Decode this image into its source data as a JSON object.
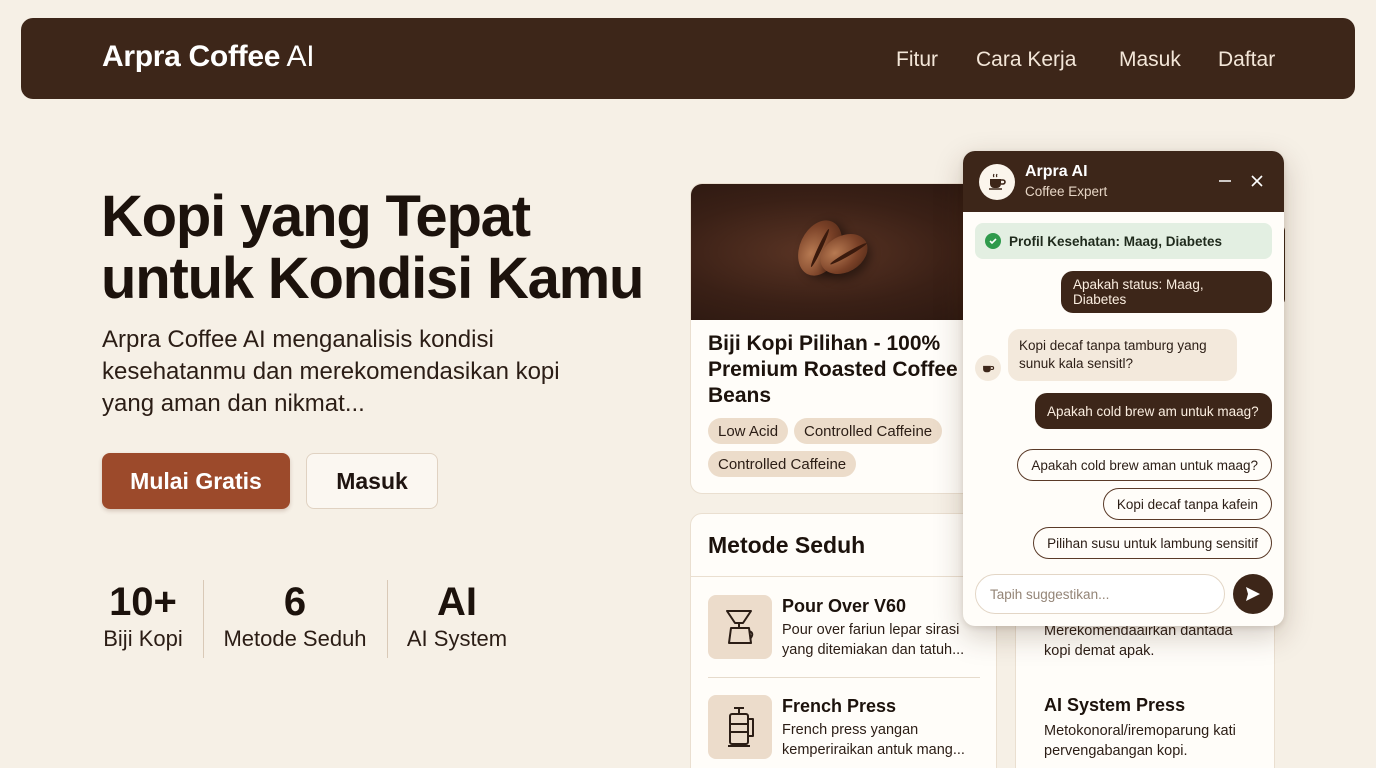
{
  "nav": {
    "brand_bold": "Arpra Coffee",
    "brand_light": "AI",
    "links": [
      "Fitur",
      "Cara Kerja",
      "Masuk",
      "Daftar"
    ]
  },
  "hero": {
    "title_line1": "Kopi yang Tepat",
    "title_line2": "untuk Kondisi Kamu",
    "subtitle": "Arpra Coffee AI menganalisis kondisi kesehatanmu dan merekomendasikan kopi yang aman dan nikmat...",
    "primary_button": "Mulai Gratis",
    "secondary_button": "Masuk"
  },
  "stats": [
    {
      "value": "10+",
      "label": "Biji Kopi"
    },
    {
      "value": "6",
      "label": "Metode Seduh"
    },
    {
      "value": "AI",
      "label": "AI System"
    }
  ],
  "product": {
    "title": "Biji Kopi Pilihan - 100% Premium Roasted Coffee Beans",
    "tags": [
      "Low Acid",
      "Controlled Caffeine",
      "Controlled Caffeine"
    ]
  },
  "brew": {
    "title": "Metode Seduh",
    "items": [
      {
        "name": "Pour Over V60",
        "desc_line1": "Pour over fariun lepar sirasi",
        "desc_line2": "yang ditemiakan dan tatuh...",
        "icon": "pour-over-icon"
      },
      {
        "name": "French Press",
        "desc_line1": "French press yangan",
        "desc_line2": "kemperiraikan antuk mang...",
        "icon": "french-press-icon"
      }
    ]
  },
  "back_card": {
    "desc_line1": "Merekomendaairkan dantada",
    "desc_line2": "kopi demat apak.",
    "item_name": "AI System Press",
    "item_desc_line1": "Metokonoral/iremoparung kati",
    "item_desc_line2": "pervengabangan kopi."
  },
  "chat": {
    "name": "Arpra AI",
    "role": "Coffee Expert",
    "profile": "Profil Kesehatan: Maag, Diabetes",
    "messages": {
      "user1": "Apakah status: Maag, Diabetes",
      "bot1": "Kopi decaf tanpa tamburg yang sunuk kala sensitl?",
      "user2": "Apakah cold brew am untuk maag?"
    },
    "suggestions": [
      "Apakah cold brew aman untuk maag?",
      "Kopi decaf tanpa kafein",
      "Pilihan susu untuk lambung sensitif"
    ],
    "input_placeholder": "Tapih suggestikan..."
  },
  "colors": {
    "nav_bg": "#3d2619",
    "page_bg": "#f6f0e6",
    "primary_button": "#9c4a2b",
    "profile_bg": "#e3efe2",
    "check_green": "#2f9a4c"
  }
}
